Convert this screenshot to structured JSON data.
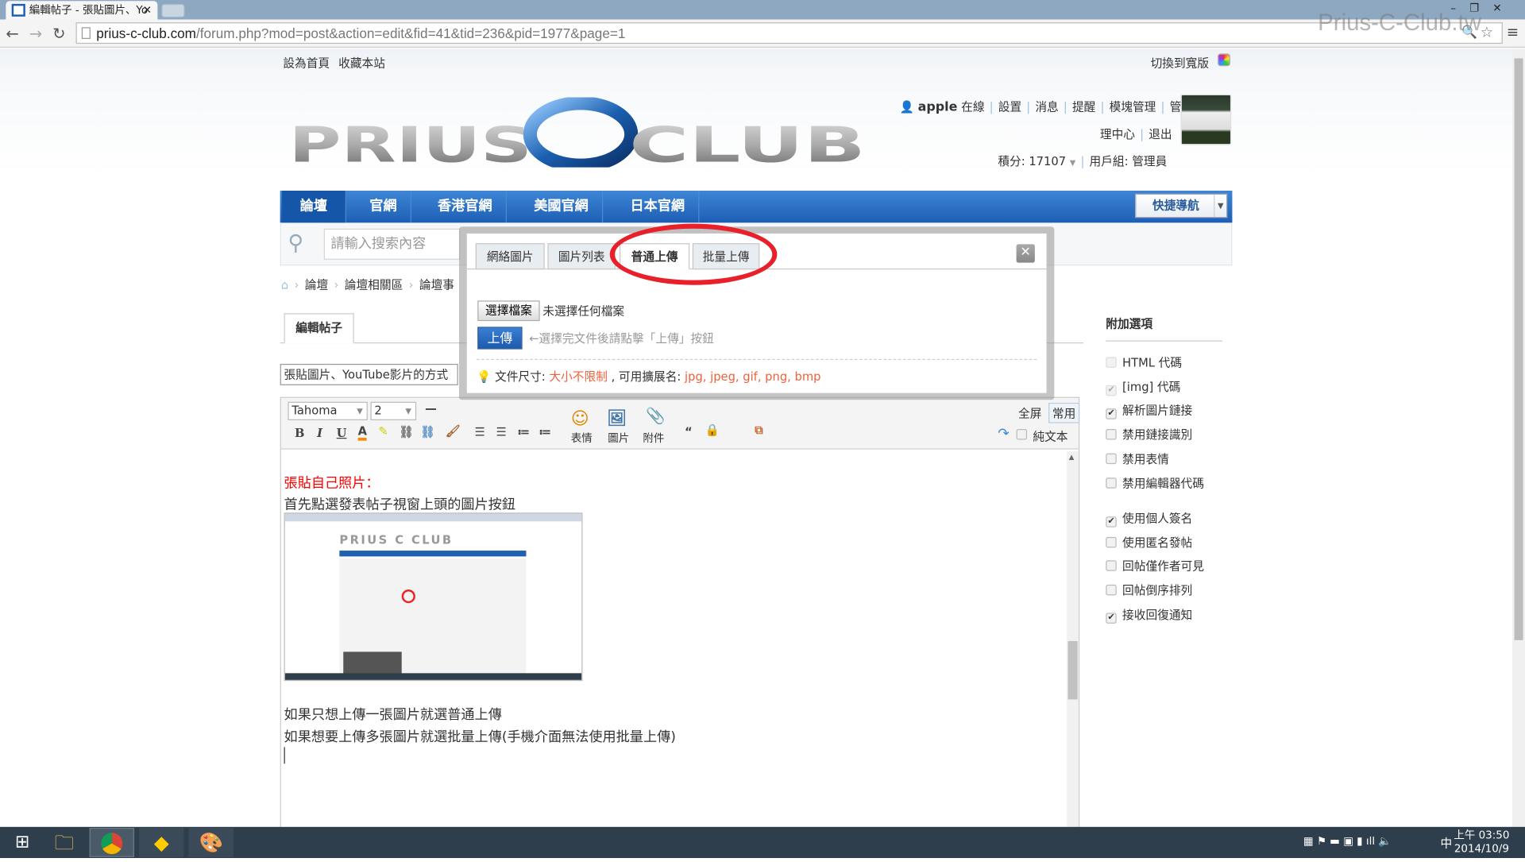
{
  "browser": {
    "tab_title": "編輯帖子 - 張貼圖片、Yo",
    "url_host": "prius-c-club.com",
    "url_path": "/forum.php?mod=post&action=edit&fid=41&tid=236&pid=1977&page=1",
    "watermark": "Prius-C-Club.tw"
  },
  "topbar": {
    "set_home": "設為首頁",
    "bookmark": "收藏本站",
    "switch_wide": "切換到寬版"
  },
  "logo_text": "PRIUS C CLUB",
  "user": {
    "name": "apple",
    "online": "在線",
    "links": [
      "設置",
      "消息",
      "提醒",
      "模塊管理",
      "管"
    ],
    "links2": [
      "理中心",
      "退出"
    ],
    "points": "積分: 17107",
    "group": "用戶組: 管理員"
  },
  "nav": {
    "items": [
      "論壇",
      "官網",
      "香港官網",
      "美國官網",
      "日本官網"
    ],
    "active": 0,
    "quick_nav": "快捷導航"
  },
  "search": {
    "placeholder": "請輸入搜索內容"
  },
  "breadcrumb": [
    "論壇",
    "論壇相關區",
    "論壇事"
  ],
  "editor": {
    "tab": "編輯帖子",
    "subject": "張貼圖片、YouTube影片的方式",
    "font": "Tahoma",
    "size": "2",
    "tool_labels": {
      "emoticon": "表情",
      "image": "圖片",
      "attach": "附件",
      "common": "常用",
      "fullscreen": "全屏",
      "plaintext": "純文本"
    },
    "content": {
      "heading": "張貼自己照片：",
      "line1": "首先點選發表帖子視窗上頭的圖片按鈕",
      "line2": "如果只想上傳一張圖片就選普通上傳",
      "line3": "如果想要上傳多張圖片就選批量上傳(手機介面無法使用批量上傳)"
    }
  },
  "sidebar": {
    "title": "附加選項",
    "options": [
      {
        "label": "HTML 代碼",
        "checked": false,
        "disabled": true
      },
      {
        "label": "[img] 代碼",
        "checked": true,
        "disabled": true
      },
      {
        "label": "解析圖片鏈接",
        "checked": true
      },
      {
        "label": "禁用鏈接識別",
        "checked": false
      },
      {
        "label": "禁用表情",
        "checked": false
      },
      {
        "label": "禁用編輯器代碼",
        "checked": false
      },
      {
        "label": "使用個人簽名",
        "checked": true
      },
      {
        "label": "使用匿名發帖",
        "checked": false
      },
      {
        "label": "回帖僅作者可見",
        "checked": false
      },
      {
        "label": "回帖倒序排列",
        "checked": false
      },
      {
        "label": "接收回復通知",
        "checked": true
      }
    ]
  },
  "modal": {
    "tabs": [
      "網絡圖片",
      "圖片列表",
      "普通上傳",
      "批量上傳"
    ],
    "active_tab": 2,
    "choose_file": "選擇檔案",
    "no_file": "未選擇任何檔案",
    "upload": "上傳",
    "upload_hint": "←選擇完文件後請點擊「上傳」按鈕",
    "size_label": "文件尺寸:",
    "size_value": "大小不限制",
    "ext_label": ", 可用擴展名:",
    "ext_value": "jpg, jpeg, gif, png, bmp"
  },
  "taskbar": {
    "time": "上午 03:50",
    "date": "2014/10/9",
    "ime": "中"
  },
  "colors": {
    "nav_blue": "#1d5eb4",
    "annotation_red": "#e8202a",
    "hint_red": "#f0603c"
  }
}
